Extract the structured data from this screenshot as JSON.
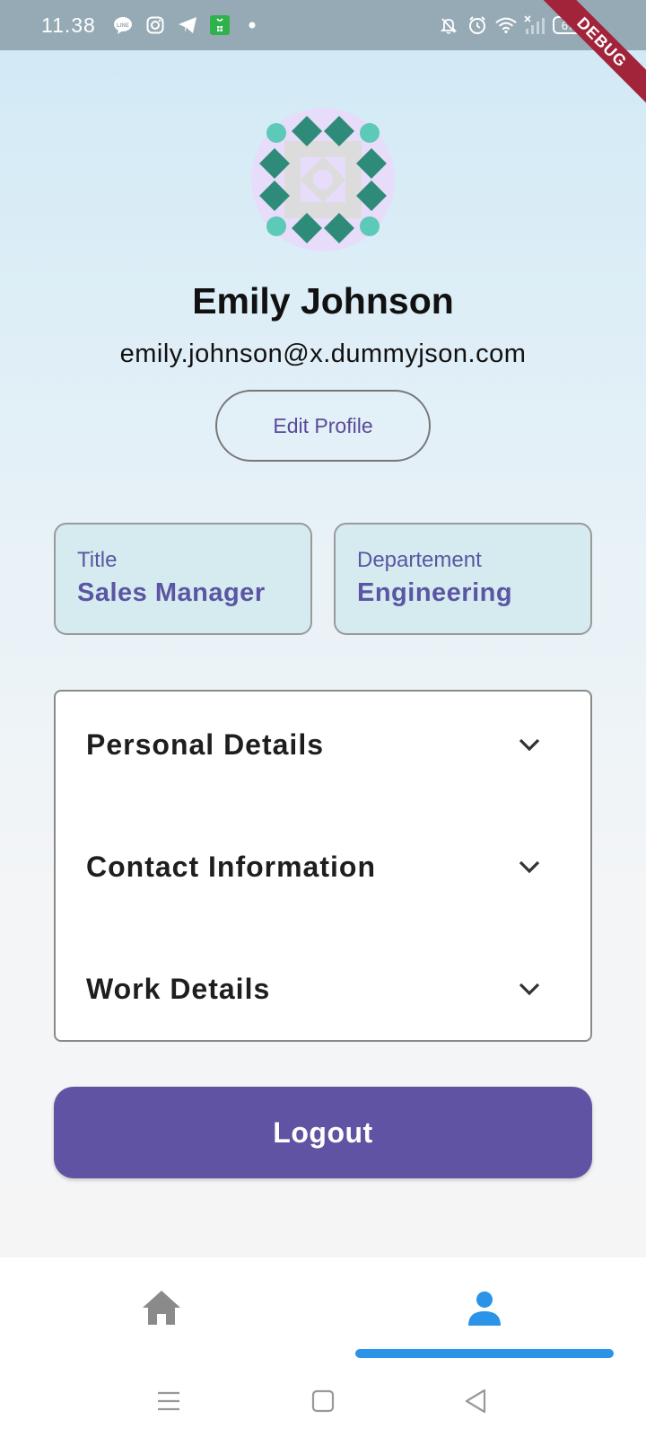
{
  "status_bar": {
    "time": "11.38",
    "battery": "67",
    "icons": [
      "line-icon",
      "instagram-icon",
      "telegram-icon",
      "app-icon",
      "dot-icon",
      "mute-icon",
      "alarm-icon",
      "wifi-icon",
      "signal-icon",
      "battery-icon"
    ],
    "debug_banner": "DEBUG"
  },
  "profile": {
    "name": "Emily Johnson",
    "email": "emily.johnson@x.dummyjson.com",
    "edit_label": "Edit Profile"
  },
  "cards": [
    {
      "label": "Title",
      "value": "Sales Manager"
    },
    {
      "label": "Departement",
      "value": "Engineering"
    }
  ],
  "sections": [
    {
      "title": "Personal Details"
    },
    {
      "title": "Contact Information"
    },
    {
      "title": "Work Details"
    }
  ],
  "logout_label": "Logout",
  "nav": {
    "items": [
      "home-icon",
      "person-icon"
    ],
    "active": "person-icon"
  },
  "colors": {
    "primary": "#6053a3",
    "accent": "#2b93e8",
    "card_bg": "#d5ebf0",
    "avatar_bg": "#e8dcfb",
    "avatar_dark": "#2e8b7a",
    "avatar_light": "#5dc9b8"
  }
}
